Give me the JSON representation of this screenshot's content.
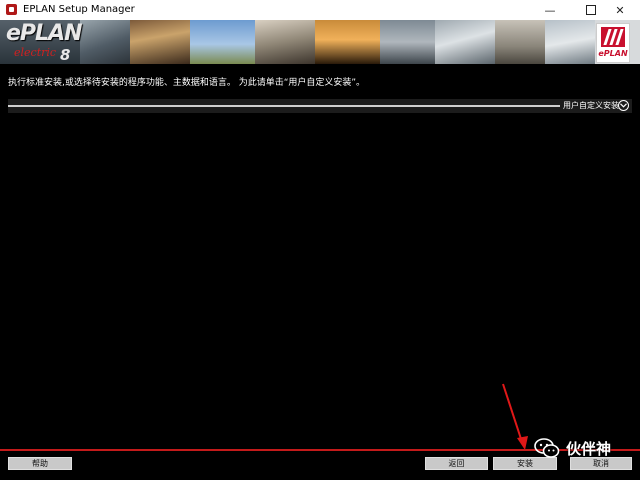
{
  "window": {
    "title": "EPLAN Setup Manager",
    "controls": {
      "minimize": "—",
      "close": "✕"
    }
  },
  "banner": {
    "logo_main": "ePLAN",
    "logo_sub": "electric",
    "logo_version": "8",
    "brand_word": "ePLAN"
  },
  "instruction": "执行标准安装,或选择待安装的程序功能、主数据和语言。 为此请单击“用户自定义安装”。",
  "custom_install": {
    "label": "用户自定义安装"
  },
  "buttons": {
    "help": "帮助",
    "back": "返回",
    "install": "安装",
    "cancel": "取消"
  },
  "watermark": {
    "text": "伙伴神"
  },
  "colors": {
    "background": "#000000",
    "accent_red": "#c41a1a",
    "button_gray": "#c9c9c9",
    "arrow_red": "#e01818"
  }
}
